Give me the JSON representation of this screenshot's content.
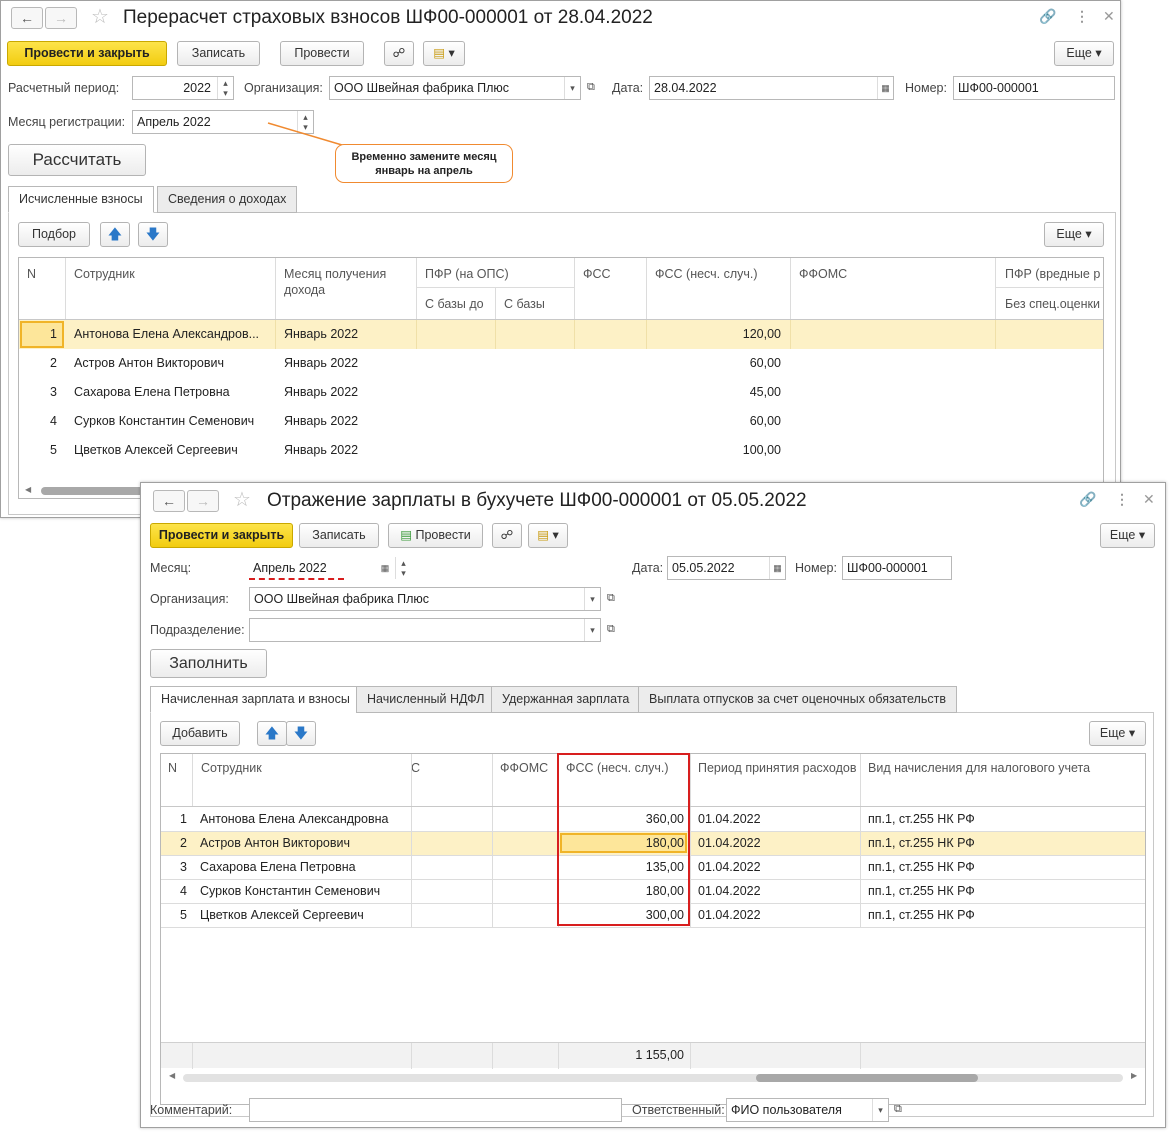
{
  "win1": {
    "title": "Перерасчет страховых взносов ШФ00-000001 от 28.04.2022",
    "post_close": "Провести и закрыть",
    "save": "Записать",
    "post": "Провести",
    "more": "Еще",
    "period_label": "Расчетный период:",
    "period_value": "2022",
    "org_label": "Организация:",
    "org_value": "ООО Швейная фабрика Плюс",
    "date_label": "Дата:",
    "date_value": "28.04.2022",
    "num_label": "Номер:",
    "num_value": "ШФ00-000001",
    "regmonth_label": "Месяц регистрации:",
    "regmonth_value": "Апрель 2022",
    "calc": "Рассчитать",
    "callout": "Временно замените месяц январь на апрель",
    "tabs": [
      "Исчисленные взносы",
      "Сведения о доходах"
    ],
    "pick": "Подбор",
    "more2": "Еще",
    "headers": {
      "n": "N",
      "emp": "Сотрудник",
      "month": "Месяц получения дохода",
      "pfr": "ПФР (на ОПС)",
      "pfr_a": "С базы до",
      "pfr_b": "С базы",
      "fss": "ФСС",
      "fss_ns": "ФСС (несч. случ.)",
      "ffoms": "ФФОМС",
      "pfr_harm": "ПФР (вредные р",
      "pfr_harm_sub": "Без спец.оценки"
    },
    "rows": [
      {
        "n": "1",
        "emp": "Антонова Елена Александров...",
        "month": "Январь 2022",
        "fss_ns": "120,00"
      },
      {
        "n": "2",
        "emp": "Астров Антон Викторович",
        "month": "Январь 2022",
        "fss_ns": "60,00"
      },
      {
        "n": "3",
        "emp": "Сахарова Елена Петровна",
        "month": "Январь 2022",
        "fss_ns": "45,00"
      },
      {
        "n": "4",
        "emp": "Сурков Константин Семенович",
        "month": "Январь 2022",
        "fss_ns": "60,00"
      },
      {
        "n": "5",
        "emp": "Цветков Алексей Сергеевич",
        "month": "Январь 2022",
        "fss_ns": "100,00"
      }
    ]
  },
  "win2": {
    "title": "Отражение зарплаты в бухучете ШФ00-000001 от 05.05.2022",
    "post_close": "Провести и закрыть",
    "save": "Записать",
    "post": "Провести",
    "more": "Еще",
    "month_label": "Месяц:",
    "month_value": "Апрель 2022",
    "date_label": "Дата:",
    "date_value": "05.05.2022",
    "num_label": "Номер:",
    "num_value": "ШФ00-000001",
    "org_label": "Организация:",
    "org_value": "ООО Швейная фабрика Плюс",
    "dept_label": "Подразделение:",
    "dept_value": "",
    "fill": "Заполнить",
    "tabs": [
      "Начисленная зарплата и взносы",
      "Начисленный НДФЛ",
      "Удержанная зарплата",
      "Выплата отпусков за счет оценочных обязательств"
    ],
    "add": "Добавить",
    "more2": "Еще",
    "headers": {
      "n": "N",
      "emp": "Сотрудник",
      "c": "С",
      "ffoms": "ФФОМС",
      "fss_ns": "ФСС (несч. случ.)",
      "period": "Период принятия расходов",
      "kind": "Вид начисления для налогового учета"
    },
    "rows": [
      {
        "n": "1",
        "emp": "Антонова Елена Александровна",
        "fss_ns": "360,00",
        "period": "01.04.2022",
        "kind": "пп.1, ст.255 НК РФ"
      },
      {
        "n": "2",
        "emp": "Астров Антон Викторович",
        "fss_ns": "180,00",
        "period": "01.04.2022",
        "kind": "пп.1, ст.255 НК РФ"
      },
      {
        "n": "3",
        "emp": "Сахарова Елена Петровна",
        "fss_ns": "135,00",
        "period": "01.04.2022",
        "kind": "пп.1, ст.255 НК РФ"
      },
      {
        "n": "4",
        "emp": "Сурков Константин Семенович",
        "fss_ns": "180,00",
        "period": "01.04.2022",
        "kind": "пп.1, ст.255 НК РФ"
      },
      {
        "n": "5",
        "emp": "Цветков Алексей Сергеевич",
        "fss_ns": "300,00",
        "period": "01.04.2022",
        "kind": "пп.1, ст.255 НК РФ"
      }
    ],
    "total": "1 155,00",
    "comment_label": "Комментарий:",
    "comment_value": "",
    "resp_label": "Ответственный:",
    "resp_value": "ФИО пользователя"
  },
  "colors": {
    "accent_yellow": "#f6d21c",
    "row_highlight": "#fdf1c6",
    "callout_border": "#f08a30",
    "highlight_box": "#d81e1e"
  }
}
